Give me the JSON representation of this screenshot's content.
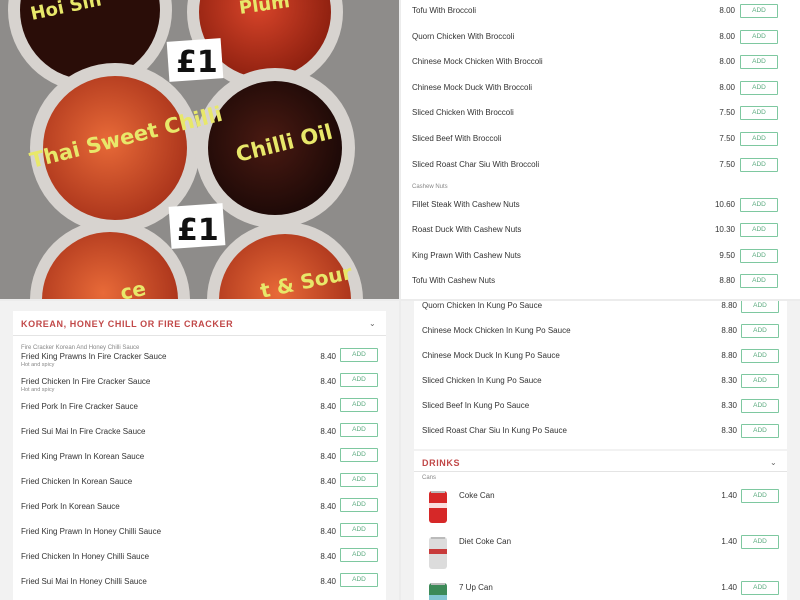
{
  "photo": {
    "labels": [
      "Hoi Sin",
      "Plum",
      "£1",
      "Thai Sweet Chilli",
      "Chilli Oil",
      "£1",
      "ce",
      "t & Sour"
    ]
  },
  "top_right": {
    "items": [
      {
        "name": "Tofu With Broccoli",
        "price": "8.00"
      },
      {
        "name": "Quorn Chicken With Broccoli",
        "price": "8.00"
      },
      {
        "name": "Chinese Mock Chicken With Broccoli",
        "price": "8.00"
      },
      {
        "name": "Chinese Mock Duck With Broccoli",
        "price": "8.00"
      },
      {
        "name": "Sliced Chicken With Broccoli",
        "price": "7.50"
      },
      {
        "name": "Sliced Beef With Broccoli",
        "price": "7.50"
      },
      {
        "name": "Sliced Roast Char Siu With Broccoli",
        "price": "7.50"
      }
    ],
    "category": "Cashew Nuts",
    "items2": [
      {
        "name": "Fillet Steak With Cashew Nuts",
        "price": "10.60"
      },
      {
        "name": "Roast Duck With Cashew Nuts",
        "price": "10.30"
      },
      {
        "name": "King Prawn With Cashew Nuts",
        "price": "9.50"
      },
      {
        "name": "Tofu With Cashew Nuts",
        "price": "8.80"
      }
    ]
  },
  "bottom_left": {
    "section_title": "KOREAN, HONEY CHILL OR FIRE CRACKER",
    "category": "Fire Cracker Korean And Honey Chilli Sauce",
    "items": [
      {
        "name": "Fried King Prawns In Fire Cracker Sauce",
        "sub": "Hot and spicy",
        "price": "8.40"
      },
      {
        "name": "Fried Chicken In Fire Cracker Sauce",
        "sub": "Hot and spicy",
        "price": "8.40"
      },
      {
        "name": "Fried Pork In Fire Cracker Sauce",
        "sub": "",
        "price": "8.40"
      },
      {
        "name": "Fried Sui Mai In Fire Cracke Sauce",
        "sub": "",
        "price": "8.40"
      },
      {
        "name": "Fried King Prawn In Korean Sauce",
        "sub": "",
        "price": "8.40"
      },
      {
        "name": "Fried Chicken In Korean Sauce",
        "sub": "",
        "price": "8.40"
      },
      {
        "name": "Fried Pork In Korean Sauce",
        "sub": "",
        "price": "8.40"
      },
      {
        "name": "Fried King Prawn In Honey Chilli Sauce",
        "sub": "",
        "price": "8.40"
      },
      {
        "name": "Fried Chicken In Honey Chilli Sauce",
        "sub": "",
        "price": "8.40"
      },
      {
        "name": "Fried Sui Mai In Honey Chilli Sauce",
        "sub": "",
        "price": "8.40"
      }
    ]
  },
  "bottom_right": {
    "items": [
      {
        "name": "Quorn Chicken In Kung Po Sauce",
        "price": "8.80"
      },
      {
        "name": "Chinese Mock Chicken In Kung Po Sauce",
        "price": "8.80"
      },
      {
        "name": "Chinese Mock Duck In Kung Po Sauce",
        "price": "8.80"
      },
      {
        "name": "Sliced Chicken In Kung Po Sauce",
        "price": "8.30"
      },
      {
        "name": "Sliced Beef In Kung Po Sauce",
        "price": "8.30"
      },
      {
        "name": "Sliced Roast Char Siu In Kung Po Sauce",
        "price": "8.30"
      }
    ],
    "drinks_title": "DRINKS",
    "drinks_category": "Cans",
    "drinks": [
      {
        "name": "Coke Can",
        "price": "1.40",
        "icon": "coke-can-icon"
      },
      {
        "name": "Diet Coke Can",
        "price": "1.40",
        "icon": "diet-coke-can-icon"
      },
      {
        "name": "7 Up Can",
        "price": "1.40",
        "icon": "7up-can-icon"
      }
    ]
  },
  "add_label": "ADD",
  "colors": {
    "accent": "#c14848",
    "add_border": "#7ec8a0",
    "add_text": "#5aaa7e"
  }
}
